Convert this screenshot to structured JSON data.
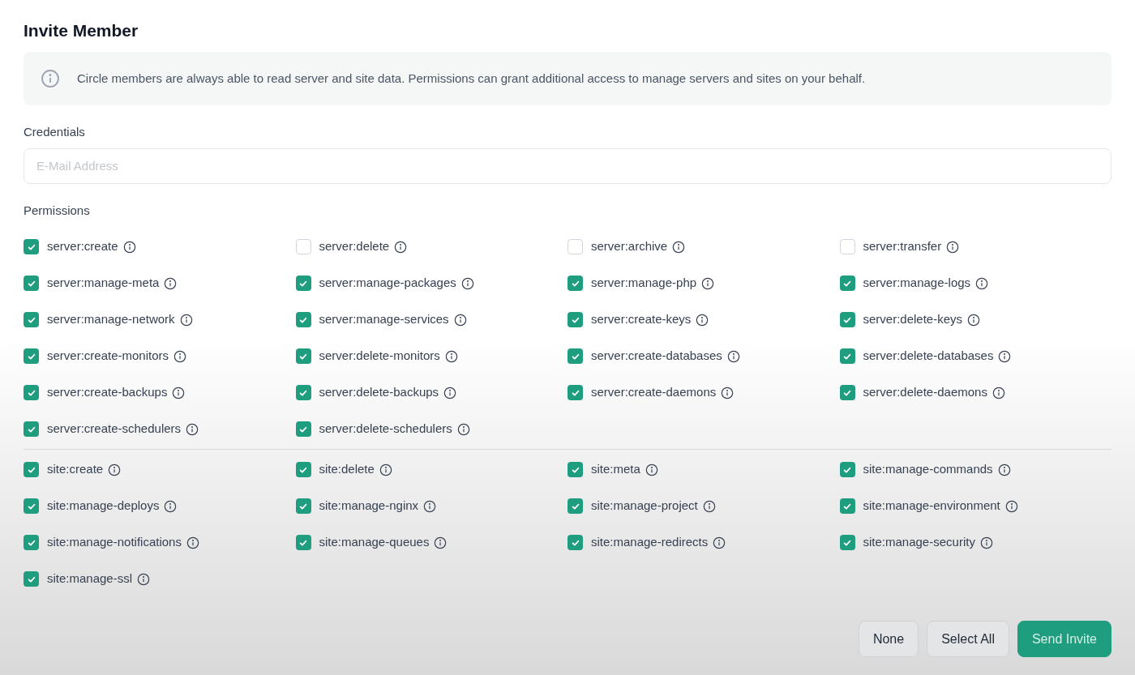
{
  "title": "Invite Member",
  "notice": "Circle members are always able to read server and site data. Permissions can grant additional access to manage servers and sites on your behalf.",
  "credentials": {
    "label": "Credentials",
    "placeholder": "E-Mail Address"
  },
  "permissions_label": "Permissions",
  "permission_groups": [
    [
      {
        "label": "server:create",
        "checked": true
      },
      {
        "label": "server:delete",
        "checked": false
      },
      {
        "label": "server:archive",
        "checked": false
      },
      {
        "label": "server:transfer",
        "checked": false
      },
      {
        "label": "server:manage-meta",
        "checked": true
      },
      {
        "label": "server:manage-packages",
        "checked": true
      },
      {
        "label": "server:manage-php",
        "checked": true
      },
      {
        "label": "server:manage-logs",
        "checked": true
      },
      {
        "label": "server:manage-network",
        "checked": true
      },
      {
        "label": "server:manage-services",
        "checked": true
      },
      {
        "label": "server:create-keys",
        "checked": true
      },
      {
        "label": "server:delete-keys",
        "checked": true
      },
      {
        "label": "server:create-monitors",
        "checked": true
      },
      {
        "label": "server:delete-monitors",
        "checked": true
      },
      {
        "label": "server:create-databases",
        "checked": true
      },
      {
        "label": "server:delete-databases",
        "checked": true
      },
      {
        "label": "server:create-backups",
        "checked": true
      },
      {
        "label": "server:delete-backups",
        "checked": true
      },
      {
        "label": "server:create-daemons",
        "checked": true
      },
      {
        "label": "server:delete-daemons",
        "checked": true
      },
      {
        "label": "server:create-schedulers",
        "checked": true
      },
      {
        "label": "server:delete-schedulers",
        "checked": true
      }
    ],
    [
      {
        "label": "site:create",
        "checked": true
      },
      {
        "label": "site:delete",
        "checked": true
      },
      {
        "label": "site:meta",
        "checked": true
      },
      {
        "label": "site:manage-commands",
        "checked": true
      },
      {
        "label": "site:manage-deploys",
        "checked": true
      },
      {
        "label": "site:manage-nginx",
        "checked": true
      },
      {
        "label": "site:manage-project",
        "checked": true
      },
      {
        "label": "site:manage-environment",
        "checked": true
      },
      {
        "label": "site:manage-notifications",
        "checked": true
      },
      {
        "label": "site:manage-queues",
        "checked": true
      },
      {
        "label": "site:manage-redirects",
        "checked": true
      },
      {
        "label": "site:manage-security",
        "checked": true
      },
      {
        "label": "site:manage-ssl",
        "checked": true
      }
    ]
  ],
  "buttons": [
    {
      "label": "None",
      "kind": "secondary"
    },
    {
      "label": "Select All",
      "kind": "secondary"
    },
    {
      "label": "Send Invite",
      "kind": "primary"
    }
  ]
}
